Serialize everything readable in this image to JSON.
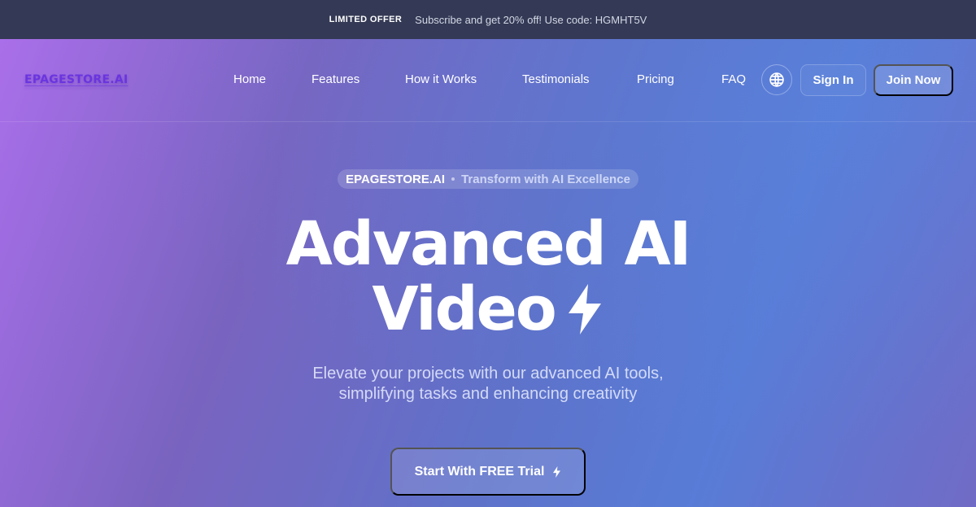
{
  "promo": {
    "badge": "LIMITED OFFER",
    "text": "Subscribe and get 20% off! Use code: HGMHT5V"
  },
  "nav": {
    "logo": "EPAGESTORE.AI",
    "links": [
      {
        "label": "Home"
      },
      {
        "label": "Features"
      },
      {
        "label": "How it Works"
      },
      {
        "label": "Testimonials"
      },
      {
        "label": "Pricing"
      },
      {
        "label": "FAQ"
      }
    ],
    "language_icon": "globe-icon",
    "sign_in": "Sign In",
    "join_now": "Join Now"
  },
  "hero": {
    "pill_brand": "EPAGESTORE.AI",
    "pill_text": "Transform with AI Excellence",
    "headline_line1": "Advanced AI",
    "headline_line2": "Video",
    "headline_icon": "lightning-bolt-icon",
    "subtitle": "Elevate your projects with our advanced AI tools, simplifying tasks and enhancing creativity",
    "cta_label": "Start With FREE Trial",
    "cta_icon": "lightning-bolt-icon"
  },
  "colors": {
    "promo_bg": "#343a55",
    "logo": "#6a35e0",
    "gradient_start": "#b072f2",
    "gradient_mid": "#6478d6",
    "gradient_end": "#746ecc"
  }
}
